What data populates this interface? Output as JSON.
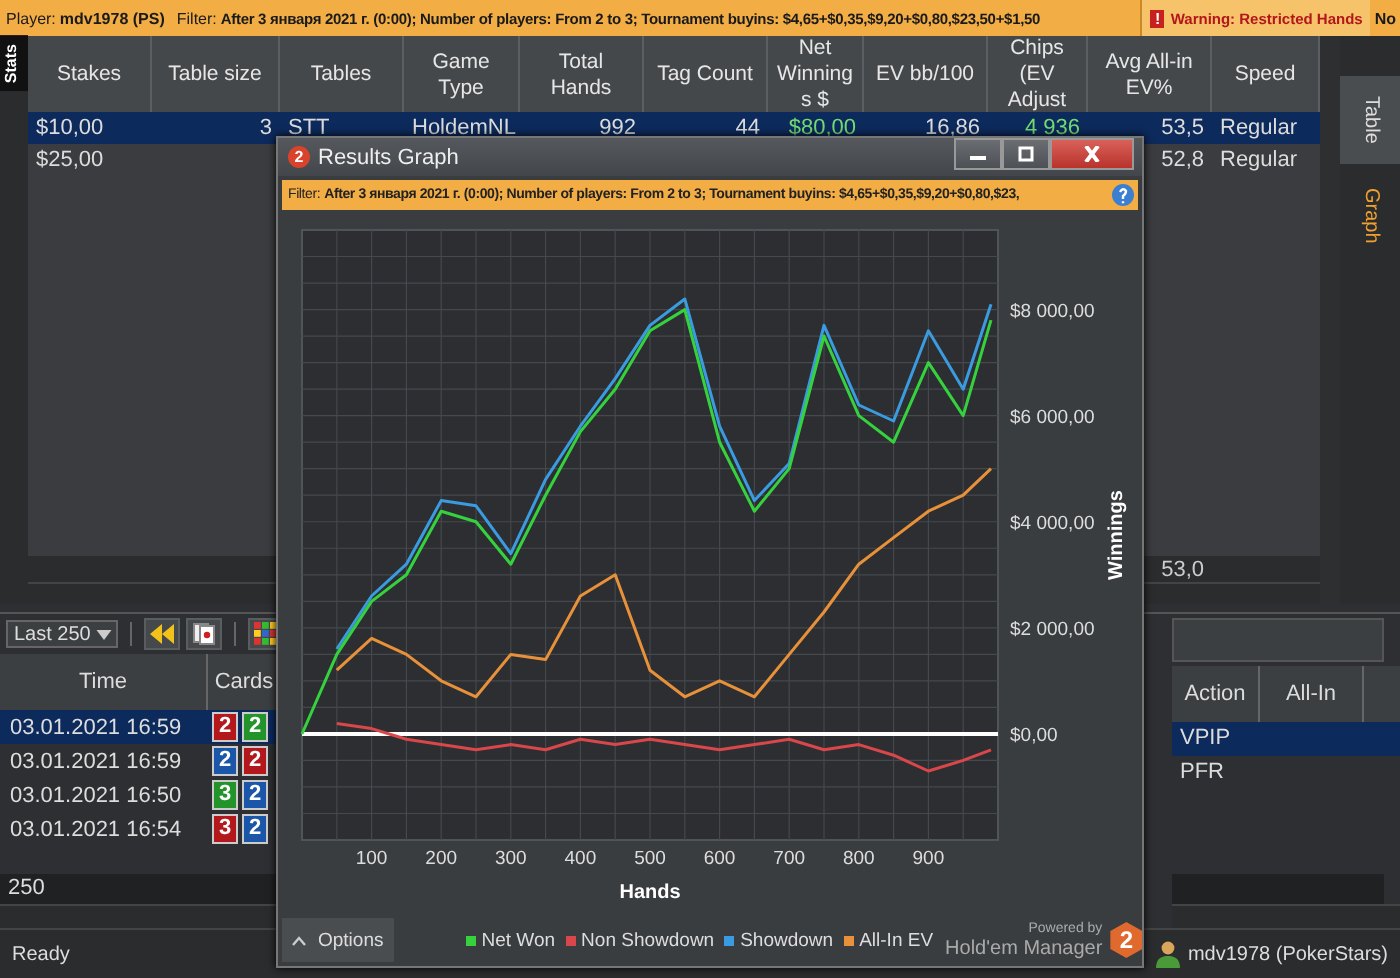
{
  "top_bar": {
    "player_label": "Player:",
    "player": "mdv1978 (PS)",
    "filter_label": "Filter:",
    "filter": "After 3 января 2021 г. (0:00); Number of players: From 2 to 3; Tournament buyins: $4,65+$0,35,$9,20+$0,80,$23,50+$1,50",
    "warning_icon": "!",
    "warning": "Warning: Restricted Hands",
    "extra": "No"
  },
  "left_tabs": [
    {
      "label": "Stats",
      "selected": true
    }
  ],
  "stats_table": {
    "columns": [
      "Stakes",
      "Table size",
      "Tables",
      "Game Type",
      "Total Hands",
      "Tag Count",
      "Net Winnings $",
      "EV bb/100",
      "Chips (EV Adjust",
      "Avg All-in EV%",
      "Speed"
    ],
    "rows": [
      {
        "cells": [
          "$10,00",
          "3",
          "STT",
          "HoldemNL",
          "992",
          "44",
          "$80,00",
          "16,86",
          "4 936",
          "53,5",
          "Regular"
        ],
        "selected": true
      },
      {
        "cells": [
          "$25,00",
          "",
          "",
          "",
          "",
          "",
          "",
          "",
          "",
          "52,8",
          "Regular"
        ],
        "selected": false
      }
    ],
    "totals": {
      "avg_all_in_ev": "53,0"
    }
  },
  "right_tabs": [
    {
      "label": "Table",
      "selected": false
    },
    {
      "label": "Graph",
      "selected": true
    }
  ],
  "hands": {
    "range": "Last 250",
    "columns": [
      "Time",
      "Cards"
    ],
    "side_columns": [
      "Action",
      "All-In"
    ],
    "rows": [
      {
        "time": "03.01.2021 16:59",
        "cards": [
          {
            "rank": "2",
            "color": "#b3181c"
          },
          {
            "rank": "2",
            "color": "#23942b"
          }
        ],
        "action": "VPIP",
        "selected": true
      },
      {
        "time": "03.01.2021 16:59",
        "cards": [
          {
            "rank": "2",
            "color": "#1b56a8"
          },
          {
            "rank": "2",
            "color": "#b3181c"
          }
        ],
        "action": "PFR",
        "selected": false
      },
      {
        "time": "03.01.2021 16:50",
        "cards": [
          {
            "rank": "3",
            "color": "#23942b"
          },
          {
            "rank": "2",
            "color": "#1b56a8"
          }
        ],
        "selected": false
      },
      {
        "time": "03.01.2021 16:54",
        "cards": [
          {
            "rank": "3",
            "color": "#b3181c"
          },
          {
            "rank": "2",
            "color": "#1b56a8"
          }
        ],
        "selected": false
      }
    ],
    "count": "250"
  },
  "status_bar": {
    "text": "Ready",
    "user": "mdv1978 (PokerStars)"
  },
  "graph_window": {
    "icon_text": "2",
    "title": "Results Graph",
    "filter_label": "Filter:",
    "filter": "After 3 января 2021 г. (0:00); Number of players: From 2 to 3; Tournament buyins: $4,65+$0,35,$9,20+$0,80,$23,",
    "chart_data": {
      "type": "line",
      "xlabel": "Hands",
      "ylabel": "Winnings",
      "grid": true,
      "x": [
        0,
        50,
        100,
        150,
        200,
        250,
        300,
        350,
        400,
        450,
        500,
        550,
        600,
        650,
        700,
        750,
        800,
        850,
        900,
        950,
        990
      ],
      "series": [
        {
          "name": "Net Won",
          "color": "#35d23e",
          "values": [
            0,
            1500,
            2500,
            3000,
            4200,
            4000,
            3200,
            4500,
            5700,
            6500,
            7600,
            8000,
            5500,
            4200,
            5000,
            7500,
            6000,
            5500,
            7000,
            6000,
            7800
          ]
        },
        {
          "name": "Non Showdown",
          "color": "#d9474a",
          "values": [
            null,
            200,
            100,
            -100,
            -200,
            -300,
            -200,
            -300,
            -100,
            -200,
            -100,
            -200,
            -300,
            -200,
            -100,
            -300,
            -200,
            -400,
            -700,
            -500,
            -300
          ]
        },
        {
          "name": "Showdown",
          "color": "#3b9be0",
          "values": [
            null,
            1600,
            2600,
            3200,
            4400,
            4300,
            3400,
            4800,
            5800,
            6700,
            7700,
            8200,
            5800,
            4400,
            5100,
            7700,
            6200,
            5900,
            7600,
            6500,
            8100
          ]
        },
        {
          "name": "All-In EV",
          "color": "#e8913a",
          "values": [
            null,
            1200,
            1800,
            1500,
            1000,
            700,
            1500,
            1400,
            2600,
            3000,
            1200,
            700,
            1000,
            700,
            1500,
            2300,
            3200,
            3700,
            4200,
            4500,
            5000
          ]
        }
      ],
      "xlim": [
        0,
        1000
      ],
      "ylim": [
        -2000,
        9500
      ],
      "xticks": [
        100,
        200,
        300,
        400,
        500,
        600,
        700,
        800,
        900
      ],
      "yticks": [
        {
          "value": 0,
          "label": "$0,00"
        },
        {
          "value": 2000,
          "label": "$2 000,00"
        },
        {
          "value": 4000,
          "label": "$4 000,00"
        },
        {
          "value": 6000,
          "label": "$6 000,00"
        },
        {
          "value": 8000,
          "label": "$8 000,00"
        }
      ]
    },
    "options": "Options",
    "powered_by": "Powered by",
    "brand": "Hold'em Manager",
    "brand_logo": "2"
  }
}
